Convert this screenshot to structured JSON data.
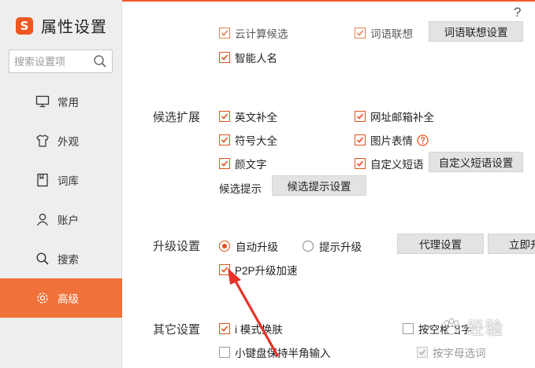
{
  "app": {
    "title": "属性设置",
    "logo_glyph": "S",
    "help_label": "?"
  },
  "search": {
    "placeholder": "搜索设置项",
    "icon": "search-icon"
  },
  "sidebar": {
    "active_color": "#f0723a",
    "items": [
      {
        "label": "常用",
        "icon": "monitor-icon"
      },
      {
        "label": "外观",
        "icon": "tshirt-icon"
      },
      {
        "label": "词库",
        "icon": "book-icon"
      },
      {
        "label": "账户",
        "icon": "user-icon"
      },
      {
        "label": "搜索",
        "icon": "search-icon"
      },
      {
        "label": "高级",
        "icon": "gear-icon",
        "active": true
      }
    ]
  },
  "top_partial": {
    "cloud_calc": "云计算候选",
    "word_association": "词语联想",
    "word_association_settings": "词语联想设置",
    "smart_name": "智能人名"
  },
  "candidate_ext": {
    "label": "候选扩展",
    "options": {
      "english_complete": "英文补全",
      "url_email_complete": "网址邮箱补全",
      "symbols": "符号大全",
      "image_emoji": "图片表情",
      "kaomoji": "颜文字",
      "custom_phrase": "自定义短语"
    },
    "custom_phrase_settings": "自定义短语设置",
    "candidate_hint_label": "候选提示",
    "candidate_hint_settings": "候选提示设置"
  },
  "upgrade": {
    "label": "升级设置",
    "auto_upgrade": "自动升级",
    "prompt_upgrade": "提示升级",
    "proxy_settings": "代理设置",
    "upgrade_now": "立即升级",
    "p2p_accel": "P2P升级加速"
  },
  "other": {
    "label": "其它设置",
    "i_mode_skin": "i 模式换肤",
    "space_to_output": "按空格出字",
    "mini_keyboard_halfwidth": "小键盘保持半角输入",
    "letter_select": "按字母选词"
  },
  "colors": {
    "accent": "#f0561f",
    "check": "#e0531e",
    "sidebar_bg": "#eeeeee",
    "arrow": "#e8312a"
  },
  "watermark": {
    "text": "经验"
  }
}
